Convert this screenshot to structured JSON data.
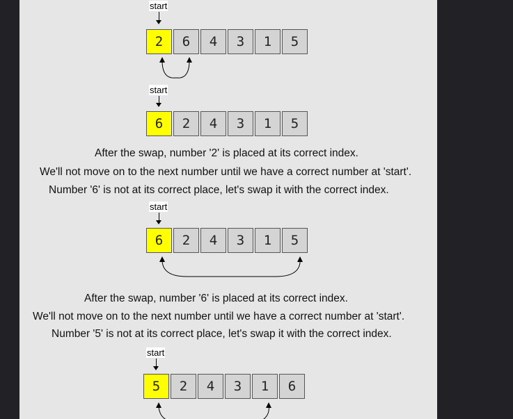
{
  "start_label": "start",
  "colors": {
    "highlight": "#ffff00",
    "cell": "#d4d4d4",
    "panel": "#e6e6e6",
    "background": "#222226"
  },
  "steps": [
    {
      "cells": [
        "2",
        "6",
        "4",
        "3",
        "1",
        "5"
      ],
      "highlight_index": 0,
      "swap": [
        0,
        1
      ]
    },
    {
      "cells": [
        "6",
        "2",
        "4",
        "3",
        "1",
        "5"
      ],
      "highlight_index": 0
    },
    {
      "cells": [
        "6",
        "2",
        "4",
        "3",
        "1",
        "5"
      ],
      "highlight_index": 0,
      "swap": [
        0,
        5
      ]
    },
    {
      "cells": [
        "5",
        "2",
        "4",
        "3",
        "1",
        "6"
      ],
      "highlight_index": 0,
      "swap": [
        0,
        4
      ]
    }
  ],
  "captions": [
    "After the swap, number '2' is placed at its correct index.",
    "We'll not move on to the next number until we have a correct number at 'start'.",
    "Number '6' is not at its correct place, let's swap it with the correct index.",
    "After the swap, number '6' is placed at its correct index.",
    "We'll not move on to the next number until we have a correct number at 'start'.",
    "Number '5' is not at its correct place, let's swap it with the correct index."
  ]
}
